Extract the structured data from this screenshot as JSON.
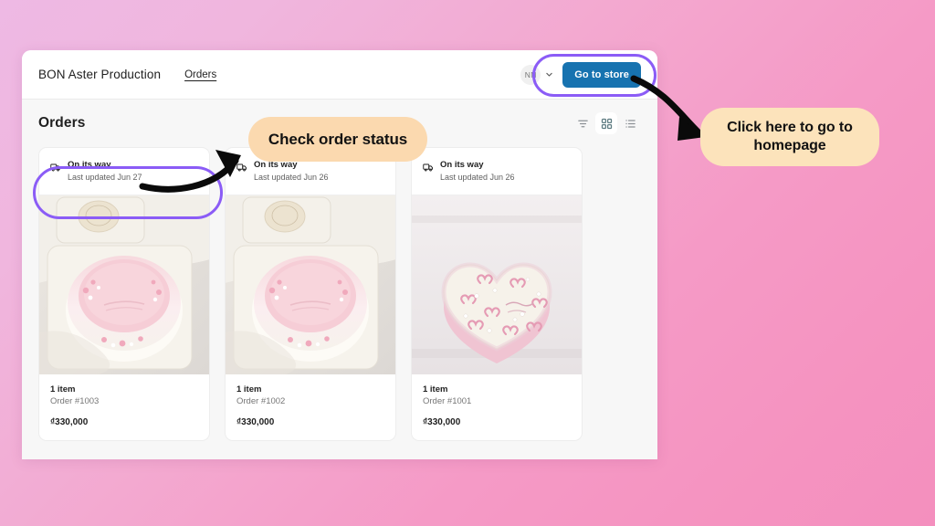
{
  "window": {
    "topbar": {
      "brand": "BON Aster Production",
      "nav_link": "Orders",
      "avatar_initials": "NN",
      "chevron_icon": "chevron-down-icon",
      "go_to_store_label": "Go to store",
      "go_to_store_color": "#1773b0"
    },
    "page": {
      "title": "Orders",
      "controls": [
        {
          "icon": "filter-icon",
          "active": false
        },
        {
          "icon": "grid-view-icon",
          "active": true
        },
        {
          "icon": "list-view-icon",
          "active": false
        }
      ]
    },
    "orders": [
      {
        "status_icon": "truck-icon",
        "status": "On its way",
        "last_updated": "Last updated Jun 27",
        "items": "1 item",
        "order_number": "Order #1003",
        "price": "₫330,000",
        "image": "bento-cake-pink-top"
      },
      {
        "status_icon": "truck-icon",
        "status": "On its way",
        "last_updated": "Last updated Jun 26",
        "items": "1 item",
        "order_number": "Order #1002",
        "price": "₫330,000",
        "image": "bento-cake-pink-top"
      },
      {
        "status_icon": "truck-icon",
        "status": "On its way",
        "last_updated": "Last updated Jun 26",
        "items": "1 item",
        "order_number": "Order #1001",
        "price": "₫330,000",
        "image": "heart-cake-pink-bows"
      }
    ]
  },
  "annotations": {
    "callout_status": "Check order status",
    "callout_homepage": "Click here to go to homepage",
    "callout_status_color": "#fbd9af",
    "callout_homepage_color": "#fce3bb",
    "highlight_color": "#8b5cf6",
    "arrow_color": "#0a0a0a"
  },
  "background": {
    "gradient_from": "#eeb9e4",
    "gradient_to": "#f48fbe"
  }
}
